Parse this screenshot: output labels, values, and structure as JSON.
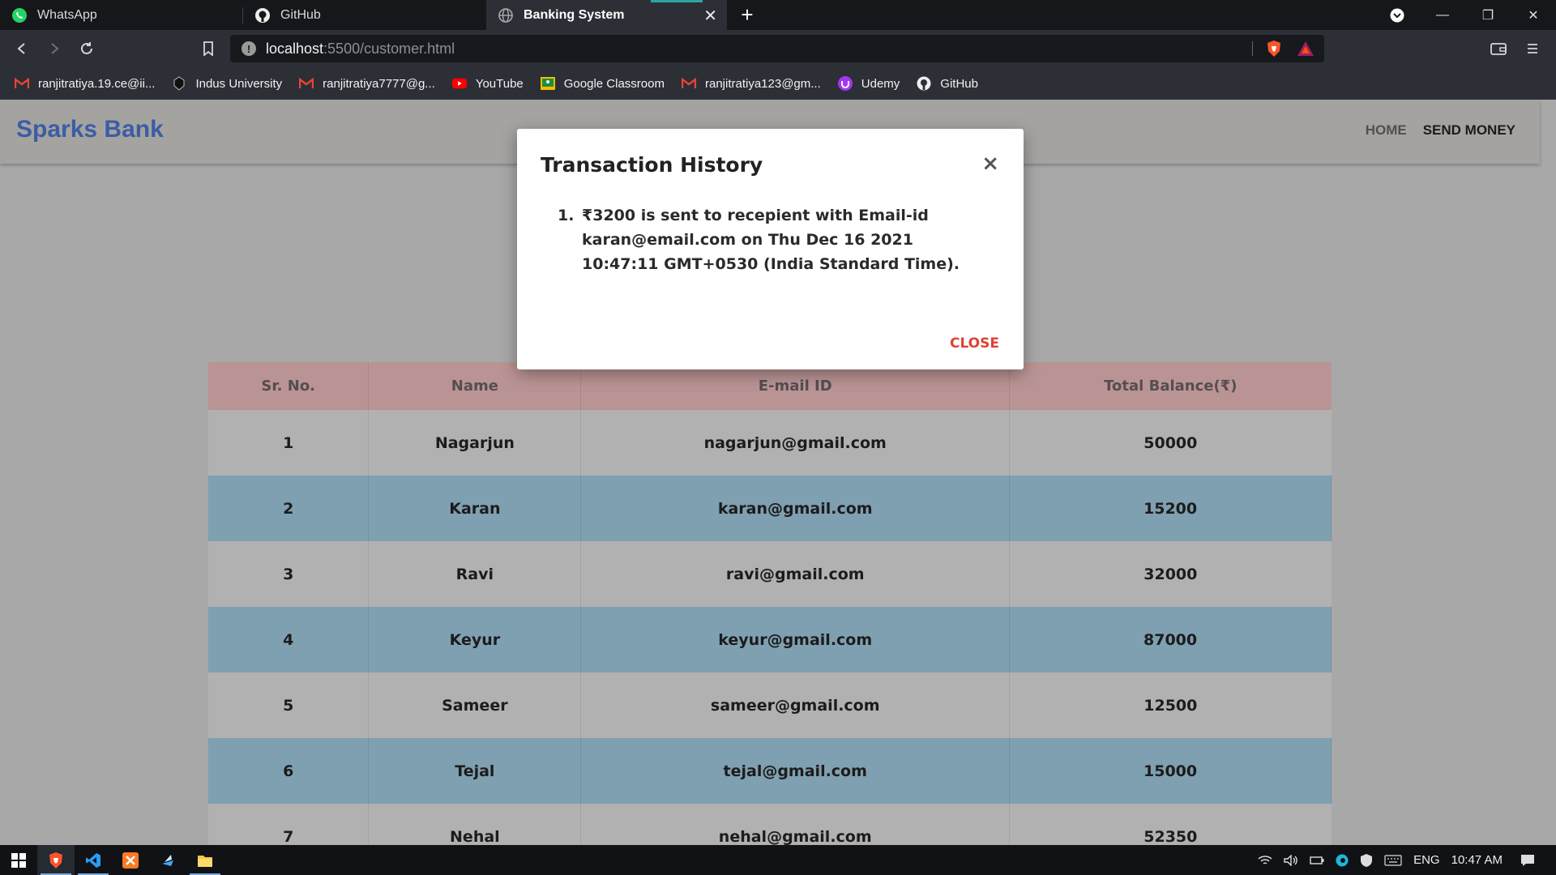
{
  "browser": {
    "tabs": [
      {
        "title": "WhatsApp",
        "icon": "whatsapp-icon"
      },
      {
        "title": "GitHub",
        "icon": "github-icon"
      },
      {
        "title": "Banking System",
        "icon": "globe-icon",
        "active": true
      }
    ],
    "url_host": "localhost",
    "url_path": ":5500/customer.html",
    "bookmarks": [
      {
        "label": "ranjitratiya.19.ce@ii...",
        "icon": "gmail-icon"
      },
      {
        "label": "Indus University",
        "icon": "indus-icon"
      },
      {
        "label": "ranjitratiya7777@g...",
        "icon": "gmail-icon"
      },
      {
        "label": "YouTube",
        "icon": "youtube-icon"
      },
      {
        "label": "Google Classroom",
        "icon": "classroom-icon"
      },
      {
        "label": "ranjitratiya123@gm...",
        "icon": "gmail-icon"
      },
      {
        "label": "Udemy",
        "icon": "udemy-icon"
      },
      {
        "label": "GitHub",
        "icon": "github-icon"
      }
    ]
  },
  "site": {
    "brand": "Sparks Bank",
    "nav": {
      "home": "HOME",
      "send_money": "SEND MONEY"
    },
    "brand_color": "#3f63b0"
  },
  "table": {
    "headers": [
      "Sr. No.",
      "Name",
      "E-mail ID",
      "Total Balance(₹)"
    ],
    "rows": [
      [
        "1",
        "Nagarjun",
        "nagarjun@gmail.com",
        "50000"
      ],
      [
        "2",
        "Karan",
        "karan@gmail.com",
        "15200"
      ],
      [
        "3",
        "Ravi",
        "ravi@gmail.com",
        "32000"
      ],
      [
        "4",
        "Keyur",
        "keyur@gmail.com",
        "87000"
      ],
      [
        "5",
        "Sameer",
        "sameer@gmail.com",
        "12500"
      ],
      [
        "6",
        "Tejal",
        "tejal@gmail.com",
        "15000"
      ],
      [
        "7",
        "Nehal",
        "nehal@gmail.com",
        "52350"
      ]
    ]
  },
  "modal": {
    "title": "Transaction History",
    "close_x": "×",
    "items": [
      "₹3200 is sent to recepient with Email-id karan@email.com on Thu Dec 16 2021 10:47:11 GMT+0530 (India Standard Time)."
    ],
    "close_label": "CLOSE"
  },
  "taskbar": {
    "language": "ENG",
    "time": "10:47 AM"
  }
}
